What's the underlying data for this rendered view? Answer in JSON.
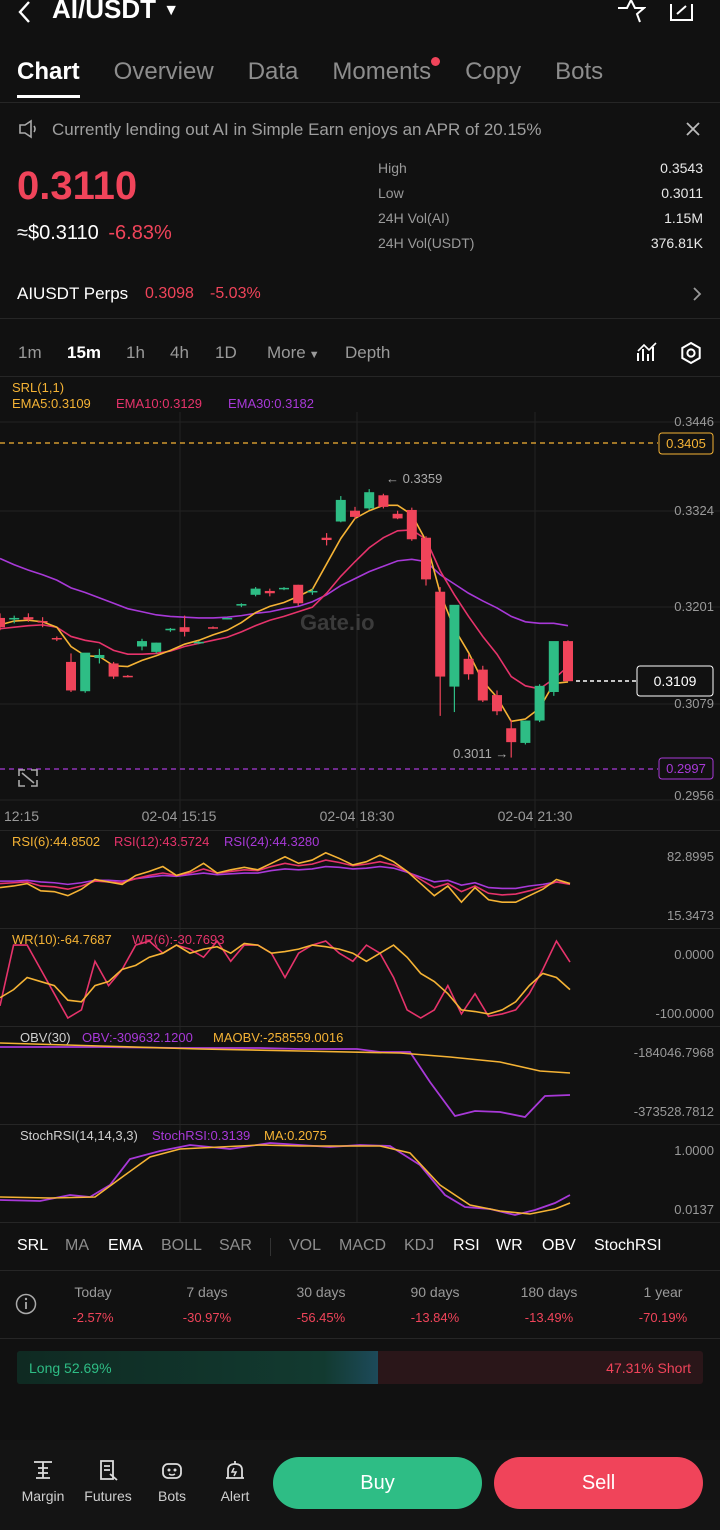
{
  "header": {
    "pair": "AI/USDT"
  },
  "tabs": [
    {
      "label": "Chart",
      "active": true
    },
    {
      "label": "Overview"
    },
    {
      "label": "Data"
    },
    {
      "label": "Moments",
      "dot": true
    },
    {
      "label": "Copy"
    },
    {
      "label": "Bots"
    }
  ],
  "notice": {
    "text": "Currently lending out AI in Simple Earn enjoys an APR of 20.15%"
  },
  "price": {
    "last": "0.3110",
    "usd": "≈$0.3110",
    "change": "-6.83%",
    "stats": [
      {
        "label": "High",
        "value": "0.3543"
      },
      {
        "label": "Low",
        "value": "0.3011"
      },
      {
        "label": "24H Vol(AI)",
        "value": "1.15M"
      },
      {
        "label": "24H Vol(USDT)",
        "value": "376.81K"
      }
    ]
  },
  "perps": {
    "label": "AIUSDT Perps",
    "price": "0.3098",
    "change": "-5.03%"
  },
  "timeframes": [
    "1m",
    "15m",
    "1h",
    "4h",
    "1D",
    "More",
    "Depth"
  ],
  "active_timeframe": "15m",
  "main_chart": {
    "srl": "SRL(1,1)",
    "ema5": "EMA5:0.3109",
    "ema10": "EMA10:0.3129",
    "ema30": "EMA30:0.3182",
    "axis": [
      "0.3446",
      "0.3324",
      "0.3201",
      "0.3079",
      "0.2956"
    ],
    "srl_upper": "0.3405",
    "srl_lower": "0.2997",
    "current_tag": "0.3109",
    "high_mark": "← 0.3359",
    "low_mark": "0.3011 →",
    "watermark": "Gate.io",
    "x_labels": [
      "12:15",
      "02-04 15:15",
      "02-04 18:30",
      "02-04 21:30"
    ],
    "colors": {
      "up": "#2ebd85",
      "down": "#f0445a",
      "ema5": "#f5b335",
      "ema10": "#e6336b",
      "ema30": "#a839d8"
    }
  },
  "chart_data": {
    "type": "candlestick",
    "ylim": [
      0.2956,
      0.3446
    ],
    "candles": [
      {
        "o": 0.3192,
        "h": 0.3198,
        "l": 0.3176,
        "c": 0.318
      },
      {
        "o": 0.319,
        "h": 0.3195,
        "l": 0.3185,
        "c": 0.3192
      },
      {
        "o": 0.3193,
        "h": 0.3198,
        "l": 0.3187,
        "c": 0.319
      },
      {
        "o": 0.3188,
        "h": 0.3193,
        "l": 0.318,
        "c": 0.3186
      },
      {
        "o": 0.3166,
        "h": 0.3168,
        "l": 0.3162,
        "c": 0.3165
      },
      {
        "o": 0.3135,
        "h": 0.3146,
        "l": 0.3096,
        "c": 0.3098
      },
      {
        "o": 0.3097,
        "h": 0.3146,
        "l": 0.3095,
        "c": 0.3147
      },
      {
        "o": 0.314,
        "h": 0.3152,
        "l": 0.3133,
        "c": 0.3144
      },
      {
        "o": 0.3133,
        "h": 0.3135,
        "l": 0.3113,
        "c": 0.3116
      },
      {
        "o": 0.3117,
        "h": 0.3118,
        "l": 0.3115,
        "c": 0.3116
      },
      {
        "o": 0.3155,
        "h": 0.3165,
        "l": 0.315,
        "c": 0.3162
      },
      {
        "o": 0.3148,
        "h": 0.316,
        "l": 0.3146,
        "c": 0.316
      },
      {
        "o": 0.3176,
        "h": 0.3179,
        "l": 0.3174,
        "c": 0.3178
      },
      {
        "o": 0.318,
        "h": 0.3195,
        "l": 0.3168,
        "c": 0.3174
      },
      {
        "o": 0.316,
        "h": 0.3162,
        "l": 0.3158,
        "c": 0.3161
      },
      {
        "o": 0.318,
        "h": 0.3181,
        "l": 0.3178,
        "c": 0.3179
      },
      {
        "o": 0.3191,
        "h": 0.3192,
        "l": 0.319,
        "c": 0.3192
      },
      {
        "o": 0.3208,
        "h": 0.3211,
        "l": 0.3206,
        "c": 0.321
      },
      {
        "o": 0.3222,
        "h": 0.3232,
        "l": 0.322,
        "c": 0.323
      },
      {
        "o": 0.3227,
        "h": 0.323,
        "l": 0.322,
        "c": 0.3224
      },
      {
        "o": 0.323,
        "h": 0.3232,
        "l": 0.3228,
        "c": 0.3231
      },
      {
        "o": 0.3235,
        "h": 0.3235,
        "l": 0.3208,
        "c": 0.3211
      },
      {
        "o": 0.3226,
        "h": 0.323,
        "l": 0.3222,
        "c": 0.3227
      },
      {
        "o": 0.3296,
        "h": 0.3302,
        "l": 0.3286,
        "c": 0.3293
      },
      {
        "o": 0.3317,
        "h": 0.335,
        "l": 0.3316,
        "c": 0.3345
      },
      {
        "o": 0.3331,
        "h": 0.3336,
        "l": 0.332,
        "c": 0.3323
      },
      {
        "o": 0.3334,
        "h": 0.3359,
        "l": 0.3332,
        "c": 0.3355
      },
      {
        "o": 0.3351,
        "h": 0.3353,
        "l": 0.3334,
        "c": 0.3336
      },
      {
        "o": 0.3327,
        "h": 0.3331,
        "l": 0.332,
        "c": 0.3321
      },
      {
        "o": 0.3332,
        "h": 0.3335,
        "l": 0.3292,
        "c": 0.3294
      },
      {
        "o": 0.3296,
        "h": 0.3298,
        "l": 0.3234,
        "c": 0.3242
      },
      {
        "o": 0.3226,
        "h": 0.3232,
        "l": 0.3065,
        "c": 0.3116
      },
      {
        "o": 0.3103,
        "h": 0.3204,
        "l": 0.307,
        "c": 0.3209
      },
      {
        "o": 0.3139,
        "h": 0.3145,
        "l": 0.3112,
        "c": 0.3119
      },
      {
        "o": 0.3125,
        "h": 0.313,
        "l": 0.3083,
        "c": 0.3085
      },
      {
        "o": 0.3092,
        "h": 0.3098,
        "l": 0.3066,
        "c": 0.3071
      },
      {
        "o": 0.3049,
        "h": 0.306,
        "l": 0.3011,
        "c": 0.3031
      },
      {
        "o": 0.303,
        "h": 0.3059,
        "l": 0.3028,
        "c": 0.3059
      },
      {
        "o": 0.3059,
        "h": 0.3106,
        "l": 0.3057,
        "c": 0.3104
      },
      {
        "o": 0.3096,
        "h": 0.316,
        "l": 0.3091,
        "c": 0.3162
      },
      {
        "o": 0.3162,
        "h": 0.3163,
        "l": 0.311,
        "c": 0.311
      }
    ],
    "ema5": [
      0.3183,
      0.3188,
      0.3189,
      0.3187,
      0.318,
      0.3155,
      0.3143,
      0.3142,
      0.313,
      0.3129,
      0.3137,
      0.3143,
      0.315,
      0.3158,
      0.3163,
      0.317,
      0.3176,
      0.3186,
      0.3199,
      0.3207,
      0.3212,
      0.322,
      0.3229,
      0.3262,
      0.3295,
      0.3321,
      0.3331,
      0.3338,
      0.3338,
      0.3326,
      0.3292,
      0.3224,
      0.3178,
      0.3147,
      0.311,
      0.3089,
      0.3058,
      0.3061,
      0.3075,
      0.3107,
      0.3109
    ],
    "ema10": [
      0.3178,
      0.318,
      0.3182,
      0.3183,
      0.318,
      0.3168,
      0.3163,
      0.316,
      0.315,
      0.3145,
      0.3145,
      0.3146,
      0.3149,
      0.3155,
      0.3159,
      0.3163,
      0.3167,
      0.3174,
      0.3182,
      0.3189,
      0.3194,
      0.32,
      0.3206,
      0.3224,
      0.3246,
      0.3265,
      0.3283,
      0.3296,
      0.3305,
      0.3306,
      0.3294,
      0.3253,
      0.3222,
      0.3194,
      0.3168,
      0.3145,
      0.3116,
      0.3104,
      0.31,
      0.3113,
      0.3129
    ],
    "ema30": [
      0.3269,
      0.3261,
      0.3254,
      0.3248,
      0.3241,
      0.3231,
      0.3225,
      0.3218,
      0.3211,
      0.3204,
      0.32,
      0.3196,
      0.3194,
      0.3193,
      0.3192,
      0.3192,
      0.3193,
      0.3195,
      0.3198,
      0.32,
      0.3204,
      0.3207,
      0.3213,
      0.3222,
      0.3234,
      0.3243,
      0.3252,
      0.3259,
      0.3266,
      0.3268,
      0.3265,
      0.3248,
      0.3236,
      0.3224,
      0.3214,
      0.3205,
      0.3194,
      0.3187,
      0.3185,
      0.3185,
      0.3182
    ]
  },
  "rsi": {
    "labels": [
      "RSI(6):44.8502",
      "RSI(12):43.5724",
      "RSI(24):44.3280"
    ],
    "axis": [
      "82.8995",
      "15.3473"
    ],
    "rsi6": [
      40,
      42,
      45,
      36,
      35,
      30,
      38,
      50,
      47,
      44,
      55,
      60,
      66,
      55,
      60,
      70,
      58,
      62,
      65,
      62,
      70,
      78,
      70,
      74,
      83,
      76,
      68,
      72,
      80,
      72,
      60,
      45,
      30,
      42,
      22,
      40,
      25,
      22,
      22,
      30,
      38,
      50,
      45
    ],
    "rsi12": [
      45,
      46,
      47,
      42,
      41,
      38,
      42,
      48,
      47,
      46,
      51,
      55,
      58,
      55,
      58,
      63,
      58,
      60,
      62,
      61,
      66,
      70,
      67,
      69,
      74,
      71,
      67,
      69,
      72,
      68,
      60,
      50,
      40,
      45,
      35,
      42,
      33,
      31,
      32,
      36,
      41,
      47,
      44
    ],
    "rsi24": [
      48,
      48,
      49,
      47,
      46,
      44,
      46,
      49,
      49,
      48,
      51,
      53,
      55,
      54,
      56,
      58,
      56,
      57,
      58,
      58,
      61,
      63,
      62,
      63,
      66,
      65,
      63,
      64,
      66,
      64,
      59,
      53,
      47,
      49,
      43,
      46,
      40,
      39,
      39,
      42,
      44,
      47,
      45
    ]
  },
  "wr": {
    "labels": [
      "WR(10):-64.7687",
      "WR(6):-30.7693"
    ],
    "axis": [
      "0.0000",
      "-100.0000"
    ],
    "wr10": [
      -75,
      -65,
      -50,
      -55,
      -60,
      -78,
      -80,
      -60,
      -55,
      -40,
      -35,
      -25,
      -20,
      -10,
      -20,
      -15,
      -12,
      -20,
      -8,
      -10,
      -20,
      -18,
      -15,
      -10,
      -12,
      -15,
      -20,
      -30,
      -20,
      -10,
      -25,
      -45,
      -55,
      -70,
      -90,
      -92,
      -95,
      -90,
      -80,
      -60,
      -45,
      -50,
      -65
    ],
    "wr6": [
      -85,
      -10,
      -10,
      -40,
      -70,
      -100,
      -90,
      -30,
      -60,
      -40,
      -10,
      -5,
      -20,
      -10,
      -15,
      -25,
      -5,
      -30,
      -10,
      -10,
      -20,
      -50,
      -20,
      -10,
      -5,
      -20,
      -30,
      -10,
      -20,
      -50,
      -90,
      -100,
      -90,
      -60,
      -95,
      -70,
      -98,
      -95,
      -90,
      -70,
      -40,
      -5,
      -31
    ]
  },
  "obv": {
    "labels": [
      "OBV(30)",
      "OBV:-309632.1200",
      "MAOBV:-258559.0016"
    ],
    "axis": [
      "-184046.7968",
      "-373528.7812"
    ]
  },
  "stochrsi": {
    "labels": [
      "StochRSI(14,14,3,3)",
      "StochRSI:0.3139",
      "MA:0.2075"
    ],
    "axis": [
      "1.0000",
      "0.0137"
    ]
  },
  "indicator_tabs": [
    {
      "label": "SRL",
      "on": true
    },
    {
      "label": "MA"
    },
    {
      "label": "EMA",
      "on": true
    },
    {
      "label": "BOLL"
    },
    {
      "label": "SAR"
    },
    {
      "label": "VOL"
    },
    {
      "label": "MACD"
    },
    {
      "label": "KDJ"
    },
    {
      "label": "RSI",
      "on": true
    },
    {
      "label": "WR",
      "on": true
    },
    {
      "label": "OBV",
      "on": true
    },
    {
      "label": "StochRSI",
      "on": true
    }
  ],
  "performance": [
    {
      "label": "Today",
      "value": "-2.57%"
    },
    {
      "label": "7 days",
      "value": "-30.97%"
    },
    {
      "label": "30 days",
      "value": "-56.45%"
    },
    {
      "label": "90 days",
      "value": "-13.84%"
    },
    {
      "label": "180 days",
      "value": "-13.49%"
    },
    {
      "label": "1 year",
      "value": "-70.19%"
    }
  ],
  "long_short": {
    "long": "Long 52.69%",
    "short": "47.31% Short",
    "long_ratio": 0.5269
  },
  "bottom_nav": [
    {
      "label": "Margin"
    },
    {
      "label": "Futures"
    },
    {
      "label": "Bots"
    },
    {
      "label": "Alert"
    }
  ],
  "actions": {
    "buy": "Buy",
    "sell": "Sell"
  }
}
